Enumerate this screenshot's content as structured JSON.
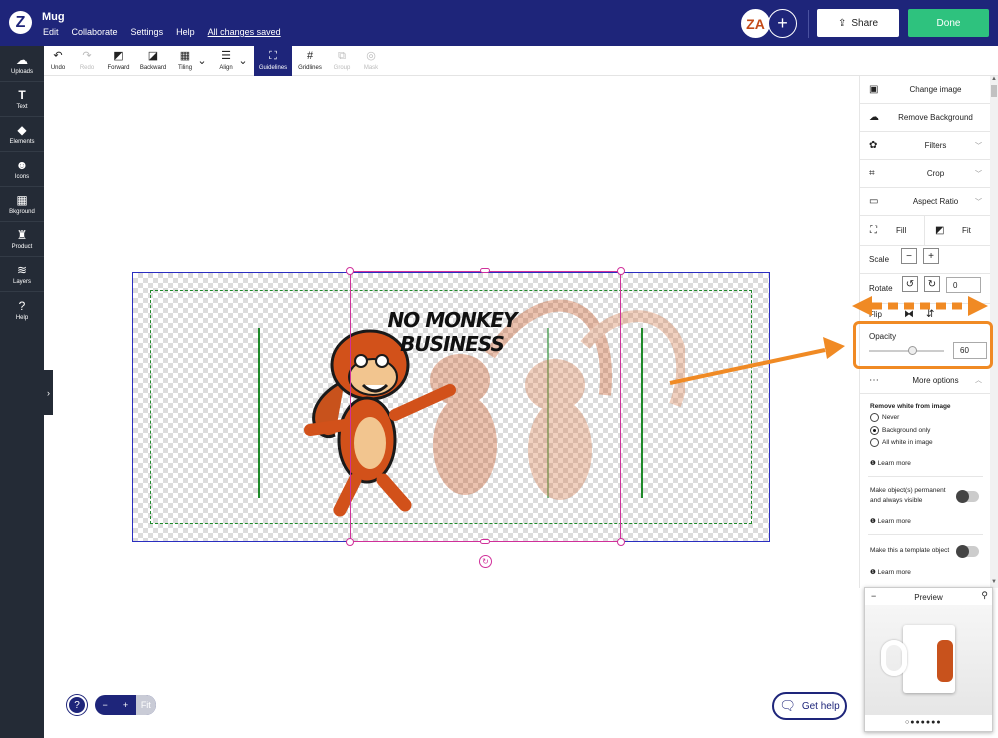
{
  "app": {
    "title": "Mug",
    "menu": [
      "Edit",
      "Collaborate",
      "Settings",
      "Help"
    ],
    "save_status": "All changes saved"
  },
  "header": {
    "share_label": "Share",
    "done_label": "Done",
    "avatar_initials": "ZA"
  },
  "sidebar": {
    "items": [
      {
        "label": "Uploads",
        "icon": "cloud-upload-icon"
      },
      {
        "label": "Text",
        "icon": "text-icon"
      },
      {
        "label": "Elements",
        "icon": "shapes-icon"
      },
      {
        "label": "Icons",
        "icon": "smiley-icon"
      },
      {
        "label": "Bkground",
        "icon": "background-icon"
      },
      {
        "label": "Product",
        "icon": "product-icon"
      },
      {
        "label": "Layers",
        "icon": "layers-icon"
      },
      {
        "label": "Help",
        "icon": "help-icon"
      }
    ]
  },
  "toolbar": {
    "undo": "Undo",
    "redo": "Redo",
    "forward": "Forward",
    "backward": "Backward",
    "tiling": "Tiling",
    "align": "Align",
    "guidelines": "Guidelines",
    "gridlines": "Gridlines",
    "group": "Group",
    "mask": "Mask"
  },
  "canvas": {
    "image_text": "NO MONKEY BUSINESS"
  },
  "panel": {
    "change_image": "Change image",
    "remove_background": "Remove Background",
    "filters": "Filters",
    "crop": "Crop",
    "aspect_ratio": "Aspect Ratio",
    "fill": "Fill",
    "fit": "Fit",
    "scale_label": "Scale",
    "rotate_label": "Rotate",
    "rotate_value": "0",
    "flip_label": "Flip",
    "opacity_label": "Opacity",
    "opacity_value": "60",
    "more_options": "More options",
    "remove_white_title": "Remove white from image",
    "remove_white_options": [
      "Never",
      "Background only",
      "All white in image"
    ],
    "remove_white_selected": "Background only",
    "learn_more": "Learn more",
    "permanent_label_1": "Make object(s) permanent",
    "permanent_label_2": "and always visible",
    "template_label": "Make this a template object"
  },
  "preview": {
    "title": "Preview"
  },
  "footer": {
    "get_help": "Get help",
    "zoom_out": "−",
    "zoom_in": "+",
    "fit": "Fit",
    "help": "?"
  },
  "colors": {
    "brand": "#1e257a",
    "done": "#2ec27e",
    "annotation": "#f08a24",
    "selection": "#d0309a",
    "safe_area": "#1f8a2a"
  }
}
